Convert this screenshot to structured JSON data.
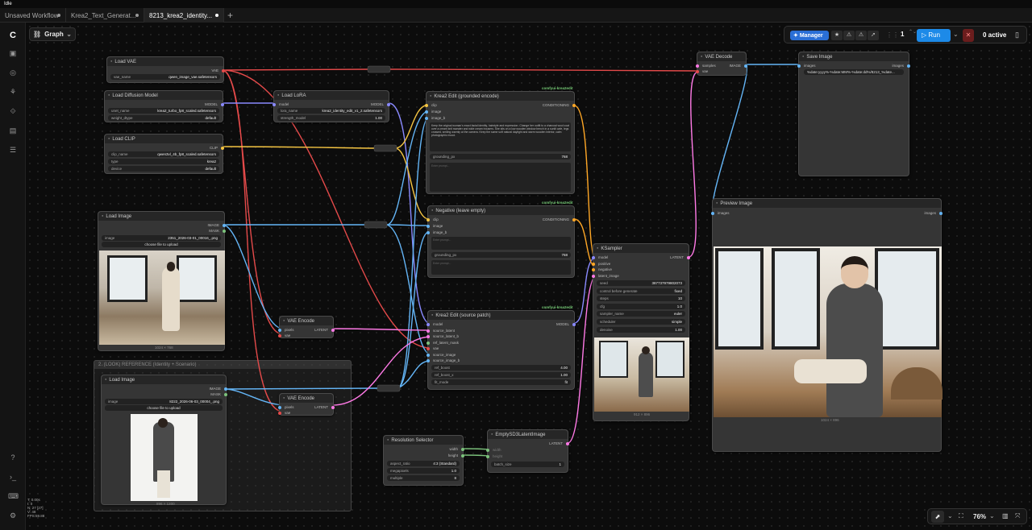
{
  "window_title": "Idle",
  "tabs": [
    {
      "label": "Unsaved Workflow"
    },
    {
      "label": "Krea2_Text_Generat..."
    },
    {
      "label": "8213_krea2_identity..."
    }
  ],
  "graph_label": "Graph",
  "toolbar": {
    "manager": "Manager",
    "run_count": "1",
    "run": "Run",
    "active": "0 active"
  },
  "group_title": "2. (LOOK) REFERENCE (Identity + Scenario)",
  "nodes": {
    "load_vae": {
      "title": "Load VAE",
      "out": "VAE",
      "w_name": "vae_name",
      "w_val": "qwen_image_vae.safetensors"
    },
    "load_diffusion": {
      "title": "Load Diffusion Model",
      "out": "MODEL",
      "w1_name": "unet_name",
      "w1_val": "krea2_turbo_fp8_scaled.safetensors",
      "w2_name": "weight_dtype",
      "w2_val": "default"
    },
    "load_clip": {
      "title": "Load CLIP",
      "out": "CLIP",
      "w1_name": "clip_name",
      "w1_val": "qwen3vl_4b_fp8_scaled.safetensors",
      "w2_name": "type",
      "w2_val": "krea2",
      "w3_name": "device",
      "w3_val": "default"
    },
    "load_lora": {
      "title": "Load LoRA",
      "in": "model",
      "out": "MODEL",
      "w1_name": "lora_name",
      "w1_val": "krea2_identity_edit_v1_2.safetensors",
      "w2_name": "strength_model",
      "w2_val": "1.00"
    },
    "load_image_1": {
      "title": "Load Image",
      "out1": "IMAGE",
      "out2": "MASK",
      "w_name": "image",
      "w_val": "2351_2026-03-01_00016_.png",
      "upload": "choose file to upload",
      "size": "1024 × 768"
    },
    "load_image_2": {
      "title": "Load Image",
      "out1": "IMAGE",
      "out2": "MASK",
      "w_name": "image",
      "w_val": "8222_2026-06-03_00004_.png",
      "upload": "choose file to upload",
      "size": "896 × 1200"
    },
    "vae_encode_1": {
      "title": "VAE Encode",
      "in1": "pixels",
      "in2": "vae",
      "out": "LATENT"
    },
    "vae_encode_2": {
      "title": "VAE Encode",
      "in1": "pixels",
      "in2": "vae",
      "out": "LATENT"
    },
    "krea_grounded": {
      "title": "Krea2 Edit (grounded encode)",
      "brand": "comfyui-krea2edit",
      "in1": "clip",
      "in2": "image",
      "in3": "image_b",
      "out": "CONDITIONING",
      "prompt": "Keep the original woman's exact facial identity, hairstyle and expression. Change her outfit to a charcoal wool coat over a cream knit sweater and wide cream trousers. She sits on a low wooden window bench in a sunlit cafe, legs crossed, smiling warmly at the camera. Keep the same soft natural daylight and warm wooden interior, calm photographic mood.",
      "w_name": "grounding_px",
      "w_val": "768",
      "ph": "Enter prompt..."
    },
    "negative": {
      "title": "Negative (leave empty)",
      "brand": "comfyui-krea2edit",
      "in1": "clip",
      "in2": "image",
      "in3": "image_b",
      "out": "CONDITIONING",
      "w_name": "grounding_px",
      "w_val": "768",
      "ph": "Enter prompt...",
      "ph2": "Enter prompt..."
    },
    "krea_source": {
      "title": "Krea2 Edit (source patch)",
      "brand": "comfyui-krea2edit",
      "in": [
        "model",
        "source_latent",
        "source_latent_b",
        "ref_latent_mask",
        "vae",
        "source_image",
        "source_image_b"
      ],
      "out": "MODEL",
      "w1_name": "ref_boost",
      "w1_val": "4.00",
      "w2_name": "ref_boost_x",
      "w2_val": "1.00",
      "w3_name": "fit_mode",
      "w3_val": "fit"
    },
    "ksampler": {
      "title": "KSampler",
      "in": [
        "model",
        "positive",
        "negative",
        "latent_image"
      ],
      "out": "LATENT",
      "widgets": [
        {
          "n": "seed",
          "v": "387737979802073"
        },
        {
          "n": "control before generate",
          "v": "fixed"
        },
        {
          "n": "steps",
          "v": "10"
        },
        {
          "n": "cfg",
          "v": "1.0"
        },
        {
          "n": "sampler_name",
          "v": "euler"
        },
        {
          "n": "scheduler",
          "v": "simple"
        },
        {
          "n": "denoise",
          "v": "1.00"
        }
      ],
      "size": "912 × 896"
    },
    "vae_decode": {
      "title": "VAE Decode",
      "in1": "samples",
      "in2": "vae",
      "out": "IMAGE"
    },
    "save_image": {
      "title": "Save Image",
      "in": "images",
      "out": "images",
      "w_val": "%date:yyyy%-%date:MM%-%date:dd%/8213_%date..."
    },
    "preview": {
      "title": "Preview Image",
      "in": "images",
      "out": "images",
      "size": "1024 × 896"
    },
    "resolution": {
      "title": "Resolution Selector",
      "out1": "width",
      "out2": "height",
      "widgets": [
        {
          "n": "aspect_ratio",
          "v": "4:3 (Standard)"
        },
        {
          "n": "megapixels",
          "v": "1.0"
        },
        {
          "n": "multiple",
          "v": "8"
        }
      ]
    },
    "empty_latent": {
      "title": "EmptySD3LatentImage",
      "out": "LATENT",
      "in1": "width",
      "in2": "height",
      "w_name": "batch_size",
      "w_val": "1"
    }
  },
  "zoom": "76%",
  "stats": [
    "T: 0.00s",
    "I: 0",
    "N: 27 [27]",
    "V: 48",
    "FPS:59.88"
  ],
  "colors": {
    "vae": "#e44a4a",
    "model": "#8a8aff",
    "clip": "#f5c542",
    "image": "#64b5f6",
    "latent": "#ff7ae6",
    "conditioning": "#ffa726",
    "mask": "#7cc27c",
    "accent": "#2a6fd6"
  }
}
